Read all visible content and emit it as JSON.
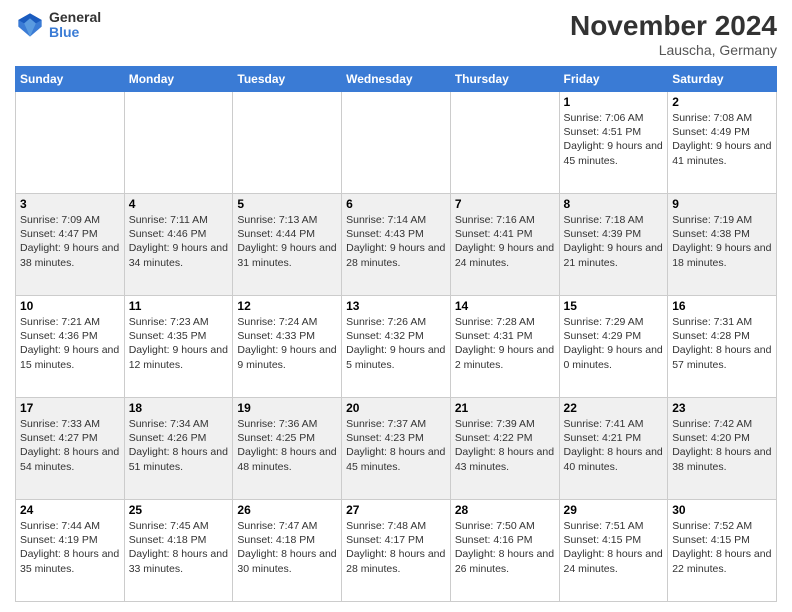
{
  "logo": {
    "line1": "General",
    "line2": "Blue"
  },
  "title": "November 2024",
  "subtitle": "Lauscha, Germany",
  "weekdays": [
    "Sunday",
    "Monday",
    "Tuesday",
    "Wednesday",
    "Thursday",
    "Friday",
    "Saturday"
  ],
  "weeks": [
    [
      {
        "day": "",
        "info": ""
      },
      {
        "day": "",
        "info": ""
      },
      {
        "day": "",
        "info": ""
      },
      {
        "day": "",
        "info": ""
      },
      {
        "day": "",
        "info": ""
      },
      {
        "day": "1",
        "info": "Sunrise: 7:06 AM\nSunset: 4:51 PM\nDaylight: 9 hours and 45 minutes."
      },
      {
        "day": "2",
        "info": "Sunrise: 7:08 AM\nSunset: 4:49 PM\nDaylight: 9 hours and 41 minutes."
      }
    ],
    [
      {
        "day": "3",
        "info": "Sunrise: 7:09 AM\nSunset: 4:47 PM\nDaylight: 9 hours and 38 minutes."
      },
      {
        "day": "4",
        "info": "Sunrise: 7:11 AM\nSunset: 4:46 PM\nDaylight: 9 hours and 34 minutes."
      },
      {
        "day": "5",
        "info": "Sunrise: 7:13 AM\nSunset: 4:44 PM\nDaylight: 9 hours and 31 minutes."
      },
      {
        "day": "6",
        "info": "Sunrise: 7:14 AM\nSunset: 4:43 PM\nDaylight: 9 hours and 28 minutes."
      },
      {
        "day": "7",
        "info": "Sunrise: 7:16 AM\nSunset: 4:41 PM\nDaylight: 9 hours and 24 minutes."
      },
      {
        "day": "8",
        "info": "Sunrise: 7:18 AM\nSunset: 4:39 PM\nDaylight: 9 hours and 21 minutes."
      },
      {
        "day": "9",
        "info": "Sunrise: 7:19 AM\nSunset: 4:38 PM\nDaylight: 9 hours and 18 minutes."
      }
    ],
    [
      {
        "day": "10",
        "info": "Sunrise: 7:21 AM\nSunset: 4:36 PM\nDaylight: 9 hours and 15 minutes."
      },
      {
        "day": "11",
        "info": "Sunrise: 7:23 AM\nSunset: 4:35 PM\nDaylight: 9 hours and 12 minutes."
      },
      {
        "day": "12",
        "info": "Sunrise: 7:24 AM\nSunset: 4:33 PM\nDaylight: 9 hours and 9 minutes."
      },
      {
        "day": "13",
        "info": "Sunrise: 7:26 AM\nSunset: 4:32 PM\nDaylight: 9 hours and 5 minutes."
      },
      {
        "day": "14",
        "info": "Sunrise: 7:28 AM\nSunset: 4:31 PM\nDaylight: 9 hours and 2 minutes."
      },
      {
        "day": "15",
        "info": "Sunrise: 7:29 AM\nSunset: 4:29 PM\nDaylight: 9 hours and 0 minutes."
      },
      {
        "day": "16",
        "info": "Sunrise: 7:31 AM\nSunset: 4:28 PM\nDaylight: 8 hours and 57 minutes."
      }
    ],
    [
      {
        "day": "17",
        "info": "Sunrise: 7:33 AM\nSunset: 4:27 PM\nDaylight: 8 hours and 54 minutes."
      },
      {
        "day": "18",
        "info": "Sunrise: 7:34 AM\nSunset: 4:26 PM\nDaylight: 8 hours and 51 minutes."
      },
      {
        "day": "19",
        "info": "Sunrise: 7:36 AM\nSunset: 4:25 PM\nDaylight: 8 hours and 48 minutes."
      },
      {
        "day": "20",
        "info": "Sunrise: 7:37 AM\nSunset: 4:23 PM\nDaylight: 8 hours and 45 minutes."
      },
      {
        "day": "21",
        "info": "Sunrise: 7:39 AM\nSunset: 4:22 PM\nDaylight: 8 hours and 43 minutes."
      },
      {
        "day": "22",
        "info": "Sunrise: 7:41 AM\nSunset: 4:21 PM\nDaylight: 8 hours and 40 minutes."
      },
      {
        "day": "23",
        "info": "Sunrise: 7:42 AM\nSunset: 4:20 PM\nDaylight: 8 hours and 38 minutes."
      }
    ],
    [
      {
        "day": "24",
        "info": "Sunrise: 7:44 AM\nSunset: 4:19 PM\nDaylight: 8 hours and 35 minutes."
      },
      {
        "day": "25",
        "info": "Sunrise: 7:45 AM\nSunset: 4:18 PM\nDaylight: 8 hours and 33 minutes."
      },
      {
        "day": "26",
        "info": "Sunrise: 7:47 AM\nSunset: 4:18 PM\nDaylight: 8 hours and 30 minutes."
      },
      {
        "day": "27",
        "info": "Sunrise: 7:48 AM\nSunset: 4:17 PM\nDaylight: 8 hours and 28 minutes."
      },
      {
        "day": "28",
        "info": "Sunrise: 7:50 AM\nSunset: 4:16 PM\nDaylight: 8 hours and 26 minutes."
      },
      {
        "day": "29",
        "info": "Sunrise: 7:51 AM\nSunset: 4:15 PM\nDaylight: 8 hours and 24 minutes."
      },
      {
        "day": "30",
        "info": "Sunrise: 7:52 AM\nSunset: 4:15 PM\nDaylight: 8 hours and 22 minutes."
      }
    ]
  ]
}
